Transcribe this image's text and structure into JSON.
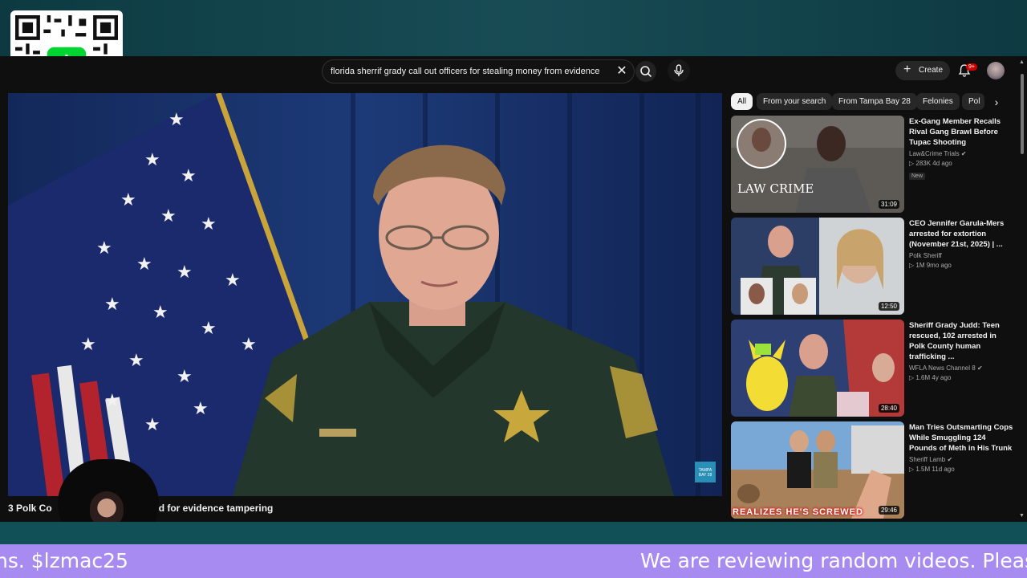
{
  "search": {
    "query": "florida sherrif grady call out officers for stealing money from evidence"
  },
  "header": {
    "create_label": "Create",
    "notifications_badge": "9+"
  },
  "chips": [
    "All",
    "From your search",
    "From Tampa Bay 28",
    "Felonies",
    "Pol"
  ],
  "video": {
    "title": "3 Polk Co",
    "title_tail": "d for evidence tampering",
    "watermark": "TAMPA BAY 28"
  },
  "streamer": {
    "name": "lzmac25"
  },
  "ticker": {
    "left": "ns. $lzmac25",
    "right": "We are reviewing random videos. Please"
  },
  "recommendations": [
    {
      "title": "Ex-Gang Member Recalls Rival Gang Brawl Before Tupac Shooting",
      "channel": "Law&Crime Trials",
      "verified": true,
      "stats": "283K  4d ago",
      "badge": "New",
      "duration": "31:09",
      "thumb_text": "LAW CRIME"
    },
    {
      "title": "CEO Jennifer Garula-Mers arrested for extortion (November 21st, 2025) | ...",
      "channel": "Polk Sheriff",
      "verified": false,
      "stats": "1M  9mo ago",
      "badge": "",
      "duration": "12:50",
      "thumb_text": ""
    },
    {
      "title": "Sheriff Grady Judd: Teen rescued, 102 arrested in Polk County human trafficking ...",
      "channel": "WFLA News Channel 8",
      "verified": true,
      "stats": "1.6M  4y ago",
      "badge": "",
      "duration": "28:40",
      "thumb_text": ""
    },
    {
      "title": "Man Tries Outsmarting Cops While Smuggling 124 Pounds of Meth in His Trunk",
      "channel": "Sheriff Lamb",
      "verified": true,
      "stats": "1.5M  11d ago",
      "badge": "",
      "duration": "29:46",
      "thumb_text": "REALIZES HE'S SCREWED"
    }
  ],
  "colors": {
    "ticker_bg": "#a88bf0",
    "yt_bg": "#0f0f0f",
    "accent_red": "#cc0000"
  }
}
